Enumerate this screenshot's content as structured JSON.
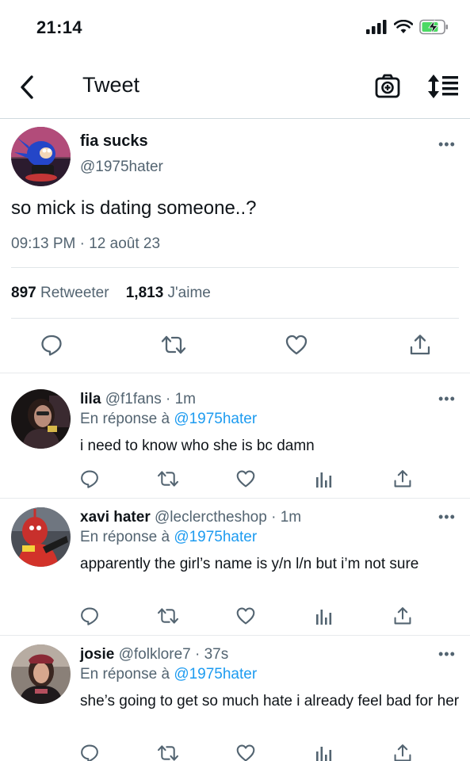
{
  "status_bar": {
    "time": "21:14"
  },
  "nav": {
    "title": "Tweet"
  },
  "main_tweet": {
    "name": "fia sucks",
    "handle": "@1975hater",
    "text": "so mick is dating someone..?",
    "timestamp": "09:13 PM · 12 août 23",
    "retweets_count": "897",
    "retweets_label": "Retweeter",
    "likes_count": "1,813",
    "likes_label": "J'aime"
  },
  "replies": [
    {
      "name": "lila",
      "handle": "@f1fans · 1m",
      "in_reply_prefix": "En réponse à",
      "in_reply_handle": "@1975hater",
      "text": "i need to know who she is bc damn"
    },
    {
      "name": "xavi hater",
      "handle": "@leclerctheshop · 1m",
      "in_reply_prefix": "En réponse à",
      "in_reply_handle": "@1975hater",
      "text": "apparently the girl’s name is y/n l/n but i’m not sure"
    },
    {
      "name": "josie",
      "handle": "@folklore7 · 37s",
      "in_reply_prefix": "En réponse à",
      "in_reply_handle": "@1975hater",
      "text": "she’s going to get so much hate i already feel bad for her"
    }
  ],
  "colors": {
    "accent": "#1d9bf0",
    "secondary_text": "#536471",
    "battery_green": "#4cd964"
  },
  "icons": [
    "back-chevron-icon",
    "camera-icon",
    "sort-icon",
    "reply-icon",
    "retweet-icon",
    "like-icon",
    "views-icon",
    "share-icon"
  ]
}
